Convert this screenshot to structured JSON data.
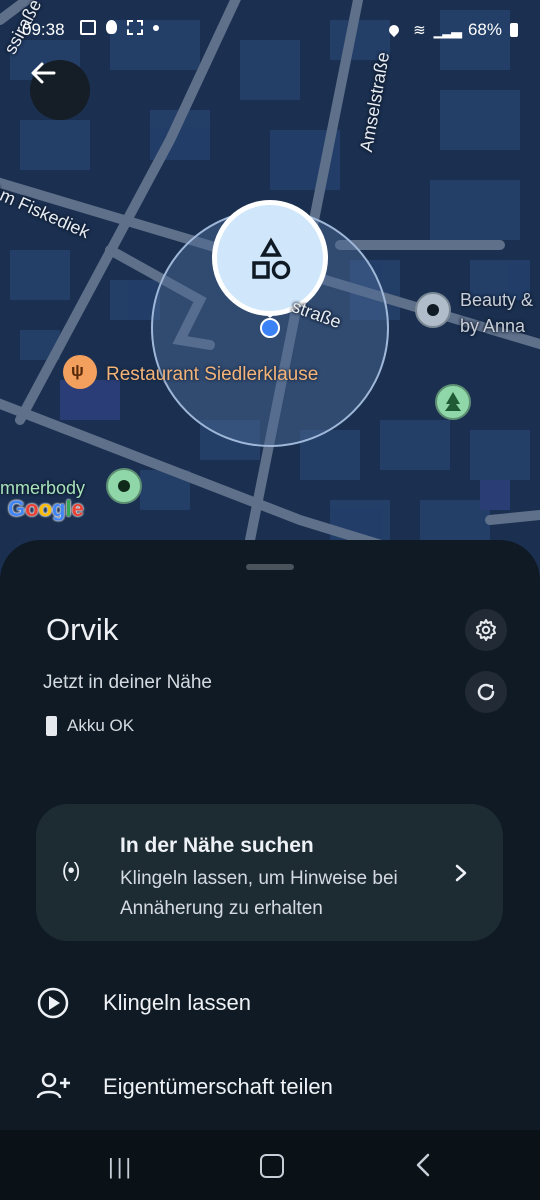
{
  "status_bar": {
    "time": "09:38",
    "battery": "68%",
    "icons_left": [
      "image-icon",
      "bulb-icon",
      "scan-icon",
      "dot-icon"
    ],
    "icons_right": [
      "location-icon",
      "wifi-icon",
      "signal-icon",
      "battery-icon"
    ]
  },
  "map": {
    "street_labels": [
      "Am Fiskediek",
      "Amselstraße",
      "straße",
      "ssiraße"
    ],
    "poi": {
      "restaurant": "Restaurant Siedlerklause",
      "beauty_line1": "Beauty &",
      "beauty_line2": "by Anna",
      "somebody": "mmerbody"
    },
    "google_logo": "Google"
  },
  "device": {
    "name": "Orvik",
    "status": "Jetzt in deiner Nähe",
    "battery": "Akku OK"
  },
  "nearby_card": {
    "title": "In der Nähe suchen",
    "description": "Klingeln lassen, um Hinweise bei Annäherung zu erhalten"
  },
  "actions": [
    {
      "label": "Klingeln lassen",
      "icon": "play-circle-icon"
    },
    {
      "label": "Eigentümerschaft teilen",
      "icon": "add-person-icon"
    }
  ],
  "colors": {
    "accent_blue": "#3b82f6",
    "sheet_bg": "#0f1a24",
    "card_bg": "#1d2b33",
    "map_bg": "#1b3050"
  }
}
